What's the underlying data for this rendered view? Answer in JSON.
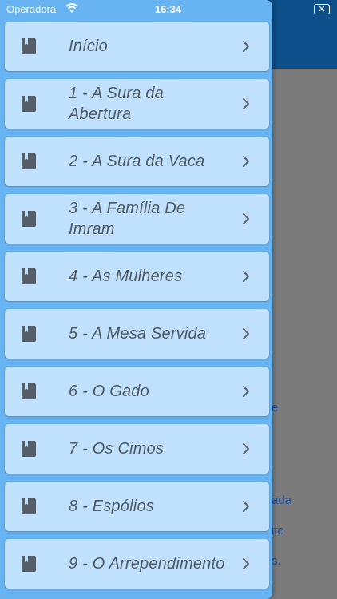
{
  "status_bar": {
    "carrier": "Operadora",
    "time": "16:34"
  },
  "background": {
    "fragments": [
      "e",
      "ada",
      "ito",
      "s."
    ]
  },
  "menu": {
    "items": [
      {
        "label": "Início"
      },
      {
        "label": "1 - A Sura da Abertura"
      },
      {
        "label": "2 - A Sura da Vaca"
      },
      {
        "label": "3 - A Família De Imram"
      },
      {
        "label": "4 - As Mulheres"
      },
      {
        "label": "5 - A Mesa Servida"
      },
      {
        "label": "6 - O Gado"
      },
      {
        "label": "7 - Os Cimos"
      },
      {
        "label": "8 - Espólios"
      },
      {
        "label": "9 - O Arrependimento"
      }
    ]
  },
  "colors": {
    "drawer_bg": "#68b4f3",
    "item_bg": "#bfe1fd",
    "text": "#505a63",
    "header_bg": "#0d4f8a"
  }
}
